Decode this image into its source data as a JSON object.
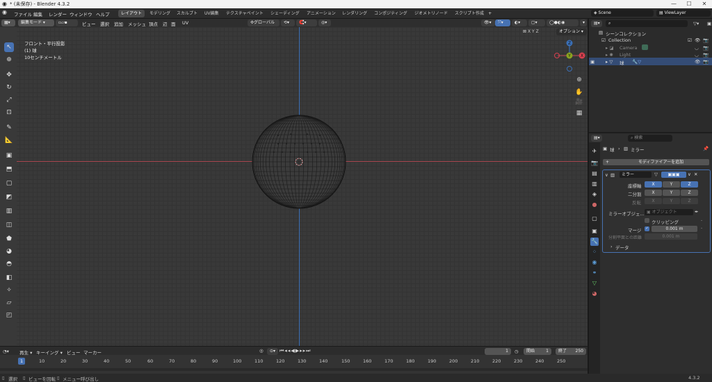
{
  "window": {
    "title": "* (未保存) - Blender 4.3.2"
  },
  "menu": [
    "ファイル",
    "編集",
    "レンダー",
    "ウィンドウ",
    "ヘルプ"
  ],
  "workspaces": [
    "レイアウト",
    "モデリング",
    "スカルプト",
    "UV編集",
    "テクスチャペイント",
    "シェーディング",
    "アニメーション",
    "レンダリング",
    "コンポジティング",
    "ジオメトリノード",
    "スクリプト作成"
  ],
  "scene": {
    "name": "Scene",
    "view_layer": "ViewLayer"
  },
  "viewport_header": {
    "mode": "編集モード",
    "menus": [
      "ビュー",
      "選択",
      "追加",
      "メッシュ",
      "頂点",
      "辺",
      "面",
      "UV"
    ],
    "transform": "グローバル",
    "options": "オプション",
    "axes": [
      "X",
      "Y",
      "Z"
    ]
  },
  "viewport_info": {
    "line1": "フロント・平行投影",
    "line2": "(1) 球",
    "line3": "10センチメートル"
  },
  "gizmo": {
    "z": "Z",
    "y": "Y",
    "x": "X"
  },
  "outliner": {
    "title": "シーンコレクション",
    "collection": "Collection",
    "items": [
      "Camera",
      "Light",
      "球"
    ]
  },
  "properties": {
    "search_placeholder": "検索",
    "breadcrumb_object": "球",
    "breadcrumb_modifier": "ミラー",
    "add_modifier": "モディファイアーを追加",
    "modifier_name": "ミラー",
    "axis_label": "座標軸",
    "bisect_label": "二分割",
    "flip_label": "反転",
    "mirror_object_label": "ミラーオブジェ...",
    "mirror_object_placeholder": "オブジェクト",
    "clipping_label": "クリッピング",
    "merge_label": "マージ",
    "merge_value": "0.001 m",
    "bisect_distance_label": "分割平面との距離",
    "bisect_distance_value": "0.001 m",
    "data_label": "データ"
  },
  "timeline": {
    "menus": [
      "再生",
      "キーイング",
      "ビュー",
      "マーカー"
    ],
    "current_frame": "1",
    "start_label": "開始",
    "start_value": "1",
    "end_label": "終了",
    "end_value": "250",
    "ticks": [
      "1",
      "10",
      "20",
      "30",
      "40",
      "50",
      "60",
      "70",
      "80",
      "90",
      "100",
      "110",
      "120",
      "130",
      "140",
      "150",
      "160",
      "170",
      "180",
      "190",
      "200",
      "210",
      "220",
      "230",
      "240",
      "250"
    ]
  },
  "status": {
    "select": "選択",
    "rotate": "ビューを回転",
    "menu": "メニュー呼び出し",
    "version": "4.3.2"
  },
  "colors": {
    "accent": "#4772b3",
    "x_axis": "#a8464f",
    "z_axis": "#3a6fb6"
  }
}
